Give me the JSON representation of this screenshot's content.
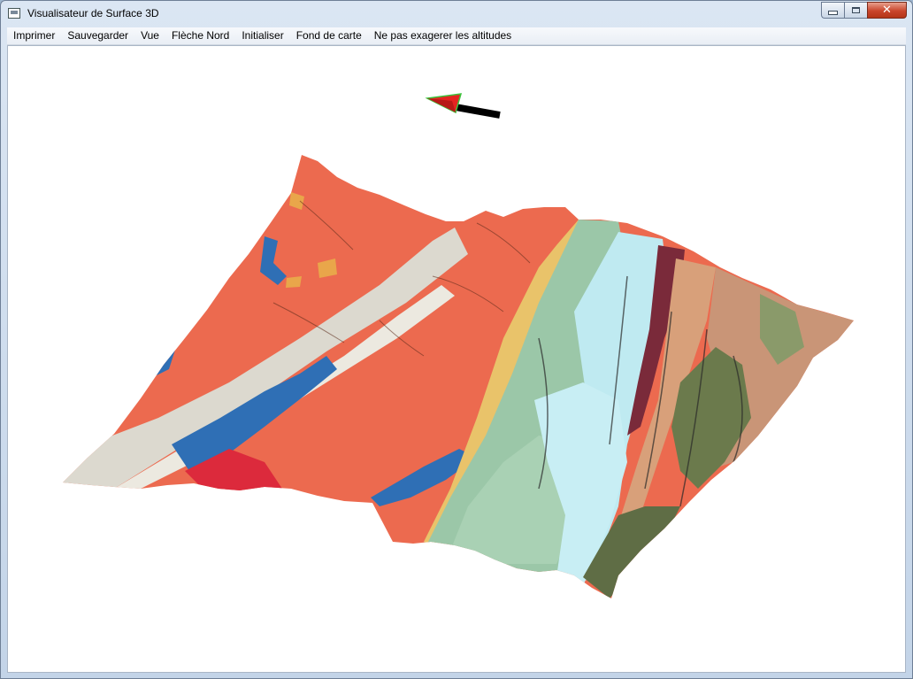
{
  "window": {
    "title": "Visualisateur de Surface 3D",
    "close_symbol": "✕",
    "colors": {
      "close": "#c9452b",
      "frame": "#c3d4e8"
    }
  },
  "menu": {
    "items": [
      {
        "id": "imprimer",
        "label": "Imprimer"
      },
      {
        "id": "sauvegarder",
        "label": "Sauvegarder"
      },
      {
        "id": "vue",
        "label": "Vue"
      },
      {
        "id": "fleche-nord",
        "label": "Flèche Nord"
      },
      {
        "id": "initialiser",
        "label": "Initialiser"
      },
      {
        "id": "fond-de-carte",
        "label": "Fond de carte"
      },
      {
        "id": "altitudes",
        "label": "Ne pas exagerer les altitudes"
      }
    ]
  },
  "icons": {
    "app": "window-app-icon",
    "north_arrow": "north-arrow-icon",
    "minimize": "minimize-icon",
    "maximize": "maximize-icon",
    "close": "close-icon"
  },
  "map": {
    "colors": {
      "orange": "#ec6a4f",
      "blue": "#2f6fb5",
      "gray": "#d9d6cc",
      "green": "#9bc7a8",
      "cyan": "#bfeaf1",
      "tan": "#d8a07a",
      "olive": "#6b7a4c",
      "yellow": "#e9c36a",
      "red": "#dc2a3c",
      "maroon": "#7a2a3a"
    }
  }
}
